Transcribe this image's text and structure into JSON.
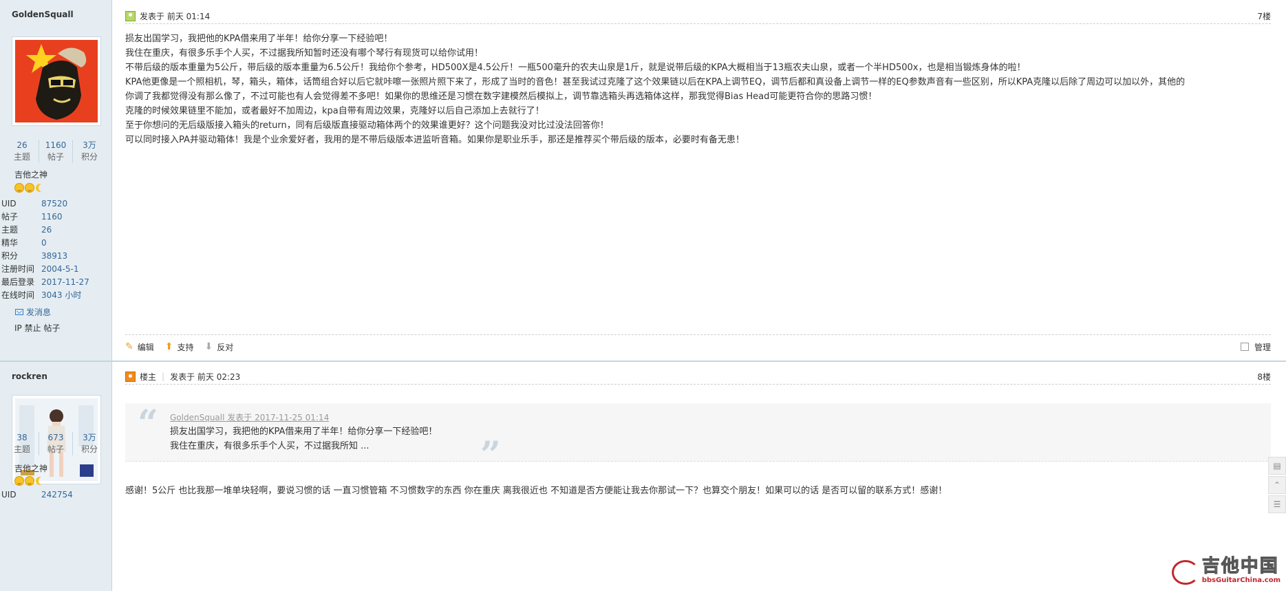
{
  "posts": [
    {
      "username": "GoldenSquall",
      "stats": [
        {
          "num": "26",
          "label": "主题"
        },
        {
          "num": "1160",
          "label": "帖子"
        },
        {
          "num": "3万",
          "label": "积分"
        }
      ],
      "group": "吉他之神",
      "info": [
        {
          "k": "UID",
          "v": "87520"
        },
        {
          "k": "帖子",
          "v": "1160"
        },
        {
          "k": "主题",
          "v": "26"
        },
        {
          "k": "精华",
          "v": "0"
        },
        {
          "k": "积分",
          "v": "38913"
        },
        {
          "k": "注册时间",
          "v": "2004-5-1"
        },
        {
          "k": "最后登录",
          "v": "2017-11-27"
        },
        {
          "k": "在线时间",
          "v": "3043 小时"
        }
      ],
      "send_msg": "发消息",
      "admin_links": "IP 禁止 帖子",
      "posted": "发表于 前天 01:14",
      "floor": "7楼",
      "lines": [
        "损友出国学习，我把他的KPA借来用了半年！给你分享一下经验吧！",
        "我住在重庆，有很多乐手个人买，不过据我所知暂时还没有哪个琴行有现货可以给你试用！",
        "不带后级的版本重量为5公斤，带后级的版本重量为6.5公斤！我给你个参考，HD500X是4.5公斤！一瓶500毫升的农夫山泉是1斤，就是说带后级的KPA大概相当于13瓶农夫山泉，或者一个半HD500x，也是相当锻炼身体的啦！",
        "KPA他更像是一个照相机，琴，箱头，箱体，话筒组合好以后它就咔嚓一张照片照下来了，形成了当时的音色！甚至我试过克隆了这个效果链以后在KPA上调节EQ，调节后都和真设备上调节一样的EQ参数声音有一些区别，所以KPA克隆以后除了周边可以加以外，其他的",
        "你调了我都觉得没有那么像了，不过可能也有人会觉得差不多吧！如果你的思维还是习惯在数字建模然后模拟上，调节靠选箱头再选箱体这样，那我觉得Bias Head可能更符合你的思路习惯！",
        "克隆的时候效果链里不能加，或者最好不加周边，kpa自带有周边效果，克隆好以后自己添加上去就行了！",
        "至于你想问的无后级版接入箱头的return，同有后级版直接驱动箱体两个的效果谁更好？这个问题我没对比过没法回答你！",
        "可以同时接入PA并驱动箱体！我是个业余爱好者，我用的是不带后级版本进监听音箱。如果你是职业乐手，那还是推荐买个带后级的版本，必要时有备无患！"
      ],
      "edit": "编辑",
      "support": "支持",
      "oppose": "反对",
      "manage": "管理"
    },
    {
      "username": "rockren",
      "stats": [
        {
          "num": "38",
          "label": "主题"
        },
        {
          "num": "673",
          "label": "帖子"
        },
        {
          "num": "3万",
          "label": "积分"
        }
      ],
      "group": "吉他之神",
      "info": [
        {
          "k": "UID",
          "v": "242754"
        }
      ],
      "op_label": "楼主",
      "posted": "发表于 前天 02:23",
      "floor": "8楼",
      "quote_head": "GoldenSquall 发表于 2017-11-25 01:14",
      "quote_lines": [
        "损友出国学习，我把他的KPA借来用了半年！给你分享一下经验吧！",
        "我住在重庆，有很多乐手个人买，不过据我所知 ..."
      ],
      "reply": "感谢！5公斤 也比我那一堆单块轻啊，要说习惯的话 一直习惯管箱 不习惯数字的东西 你在重庆 离我很近也 不知道是否方便能让我去你那试一下？也算交个朋友！如果可以的话 是否可以留的联系方式！感谢！"
    }
  ],
  "watermark": {
    "big": "吉他中国",
    "small": "bbsGuitarChina.com"
  },
  "colors": {
    "sidebar_bg": "#e5edf2",
    "link": "#336699",
    "border": "#c2d5e3"
  }
}
